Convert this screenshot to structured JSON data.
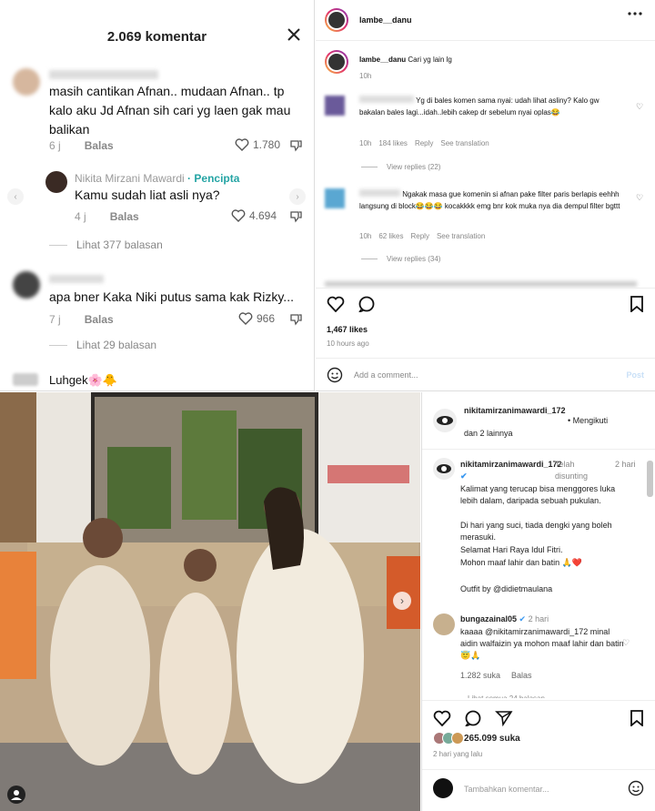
{
  "tiktok": {
    "title": "2.069 komentar",
    "comments": [
      {
        "text": "masih cantikan Afnan.. mudaan Afnan.. tp kalo aku Jd Afnan sih cari yg laen gak mau balikan",
        "age": "6 j",
        "reply_label": "Balas",
        "likes": "1.780"
      },
      {
        "author": "Nikita Mirzani Mawardi",
        "badge": "Pencipta",
        "text": "Kamu sudah liat asli nya?",
        "age": "4 j",
        "reply_label": "Balas",
        "likes": "4.694"
      },
      {
        "text": "apa bner Kaka Niki putus sama kak Rizky...",
        "age": "7 j",
        "reply_label": "Balas",
        "likes": "966"
      },
      {
        "text": "Luhgek🌸🐥"
      }
    ],
    "view_more_1": "Lihat 377 balasan",
    "view_more_2": "Lihat 29 balasan"
  },
  "ig_top": {
    "username": "lambe__danu",
    "caption_user": "lambe__danu",
    "caption": "Cari yg lain lg",
    "caption_age": "10h",
    "comments": [
      {
        "text": "Yg di bales komen sama nyai: udah lihat asliny? Kalo gw bakalan bales lagi...idah..lebih cakep dr sebelum nyai oplas😂",
        "age": "10h",
        "likes": "184 likes",
        "reply_label": "Reply",
        "translate": "See translation",
        "view_replies": "View replies (22)"
      },
      {
        "text": "Ngakak masa gue komenin si afnan pake filter paris berlapis eehhh langsung di block😂😂😂 kocakkkk emg bnr kok muka nya dia dempul filter bgttt",
        "age": "10h",
        "likes": "62 likes",
        "reply_label": "Reply",
        "translate": "See translation",
        "view_replies": "View replies (34)"
      }
    ],
    "post_likes": "1,467 likes",
    "post_age": "10 hours ago",
    "add_comment_placeholder": "Add a comment...",
    "post_button": "Post"
  },
  "ig_bottom": {
    "header_user": "nikitamirzanimawardi_172",
    "header_sub": "dan 2 lainnya",
    "follow_label": "Mengikuti",
    "caption_user": "nikitamirzanimawardi_172",
    "caption_edited": "Telah disunting",
    "caption_age": "2 hari",
    "caption_lines": [
      "Kalimat yang terucap bisa menggores luka lebih dalam, daripada sebuah pukulan.",
      "Di hari yang suci, tiada dengki yang boleh merasuki.",
      "Selamat Hari Raya Idul Fitri.",
      "Mohon maaf lahir dan batin 🙏❤️",
      "Outfit by @didietmaulana"
    ],
    "comment_user": "bungazainal05",
    "comment_age": "2 hari",
    "comment_text": "kaaaa @nikitamirzanimawardi_172 minal aidin walfaizin ya mohon maaf lahir dan batin 😇🙏",
    "comment_likes": "1.282 suka",
    "comment_reply": "Balas",
    "view_all": "Lihat semua 24 balasan",
    "post_likes": "265.099 suka",
    "post_age": "2 hari yang lalu",
    "add_comment_placeholder": "Tambahkan komentar..."
  },
  "colors": {
    "tiktok_creator": "#24a4a4",
    "ig_verified": "#3897f0",
    "link_blue": "#a9cff5"
  }
}
